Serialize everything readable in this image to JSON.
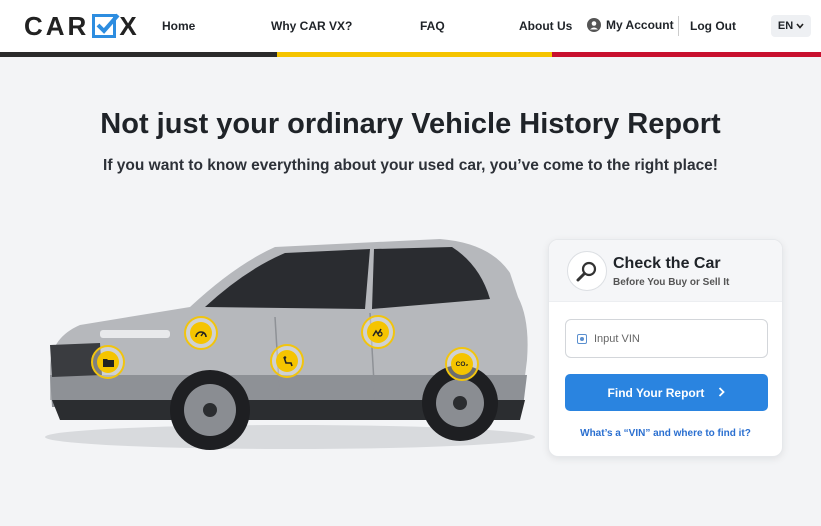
{
  "brand": {
    "part1": "CAR",
    "part2": "X"
  },
  "nav": {
    "home": "Home",
    "why": "Why CAR VX?",
    "faq": "FAQ",
    "about": "About Us",
    "account": "My Account",
    "logout": "Log Out",
    "lang": "EN"
  },
  "hero": {
    "title": "Not just your ordinary Vehicle History Report",
    "subtitle": "If you want to know everything about your used car, you’ve come to the right place!"
  },
  "hotspots": [
    "folder-icon",
    "speedometer-icon",
    "seat-icon",
    "damage-icon",
    "co2-icon"
  ],
  "hotspot_co2_label": "CO₂",
  "card": {
    "title": "Check the Car",
    "subtitle": "Before You Buy or Sell It",
    "vin_placeholder": "Input VIN",
    "button": "Find Your Report",
    "link": "What’s a “VIN” and where to find it?"
  },
  "colors": {
    "stripe_dark": "#2b2b2b",
    "stripe_yellow": "#f5c400",
    "stripe_red": "#c8102e",
    "accent": "#2a84e0",
    "hotspot": "#f5c400"
  }
}
